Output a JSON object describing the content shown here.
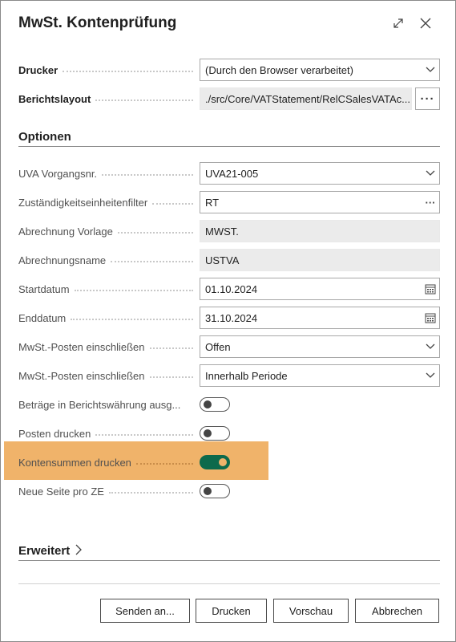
{
  "dialog": {
    "title": "MwSt. Kontenprüfung",
    "expand_icon": "expand-icon",
    "close_icon": "close-icon"
  },
  "fields": {
    "drucker": {
      "label": "Drucker",
      "value": "(Durch den Browser verarbeitet)"
    },
    "berichtslayout": {
      "label": "Berichtslayout",
      "value": "./src/Core/VATStatement/RelCSalesVATAc...",
      "more": "···"
    }
  },
  "optionen": {
    "title": "Optionen",
    "uva_vorgangsnr": {
      "label": "UVA Vorgangsnr.",
      "value": "UVA21-005"
    },
    "zustaendigkeit": {
      "label": "Zuständigkeitseinheitenfilter",
      "value": "RT",
      "more": "···"
    },
    "abrechnung_vorlage": {
      "label": "Abrechnung Vorlage",
      "value": "MWST."
    },
    "abrechnungsname": {
      "label": "Abrechnungsname",
      "value": "USTVA"
    },
    "startdatum": {
      "label": "Startdatum",
      "value": "01.10.2024"
    },
    "enddatum": {
      "label": "Enddatum",
      "value": "31.10.2024"
    },
    "mwst_posten_1": {
      "label": "MwSt.-Posten einschließen",
      "value": "Offen"
    },
    "mwst_posten_2": {
      "label": "MwSt.-Posten einschließen",
      "value": "Innerhalb Periode"
    },
    "betraege": {
      "label": "Beträge in Berichtswährung ausg...",
      "on": false
    },
    "posten_drucken": {
      "label": "Posten drucken",
      "on": false
    },
    "kontensummen": {
      "label": "Kontensummen drucken",
      "on": true
    },
    "neue_seite": {
      "label": "Neue Seite pro ZE",
      "on": false
    }
  },
  "erweitert": {
    "title": "Erweitert"
  },
  "buttons": {
    "senden": "Senden an...",
    "drucken": "Drucken",
    "vorschau": "Vorschau",
    "abbrechen": "Abbrechen"
  },
  "colors": {
    "highlight": "#f0b36a",
    "toggle_on": "#0d6a4c",
    "readonly_bg": "#ebebeb"
  }
}
